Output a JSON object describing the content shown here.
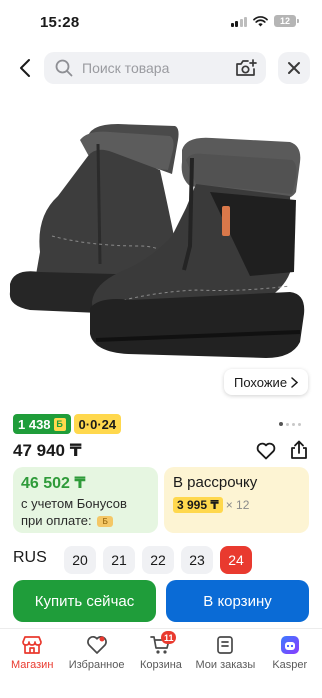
{
  "status_bar": {
    "time": "15:28",
    "battery": "12"
  },
  "search": {
    "placeholder": "Поиск товара"
  },
  "product": {
    "similar_label": "Похожие",
    "badge_price": "1 438",
    "badge_coin": "Б",
    "badge_installment": "0·0·24",
    "price": "47 940 ₸"
  },
  "bonus_card": {
    "price": "46 502 ₸",
    "line1": "с учетом Бонусов",
    "line2": "при оплате:",
    "coin": "Б"
  },
  "installment_card": {
    "title": "В рассрочку",
    "price": "3 995 ₸",
    "multiplier": "× 12"
  },
  "sizes": {
    "label": "RUS",
    "options": [
      "20",
      "21",
      "22",
      "23",
      "24"
    ],
    "selected": "24"
  },
  "actions": {
    "buy_now": "Купить сейчас",
    "add_to_cart": "В корзину"
  },
  "tabs": [
    {
      "label": "Магазин",
      "icon": "store-icon"
    },
    {
      "label": "Избранное",
      "icon": "heart-icon"
    },
    {
      "label": "Корзина",
      "icon": "cart-icon",
      "badge": "11"
    },
    {
      "label": "Мои заказы",
      "icon": "orders-icon"
    },
    {
      "label": "Kasper",
      "icon": "kasper-icon"
    }
  ],
  "colors": {
    "accent_red": "#e93a2f",
    "green": "#1f9d3a",
    "blue": "#0a6bd6",
    "yellow": "#ffd84d"
  }
}
